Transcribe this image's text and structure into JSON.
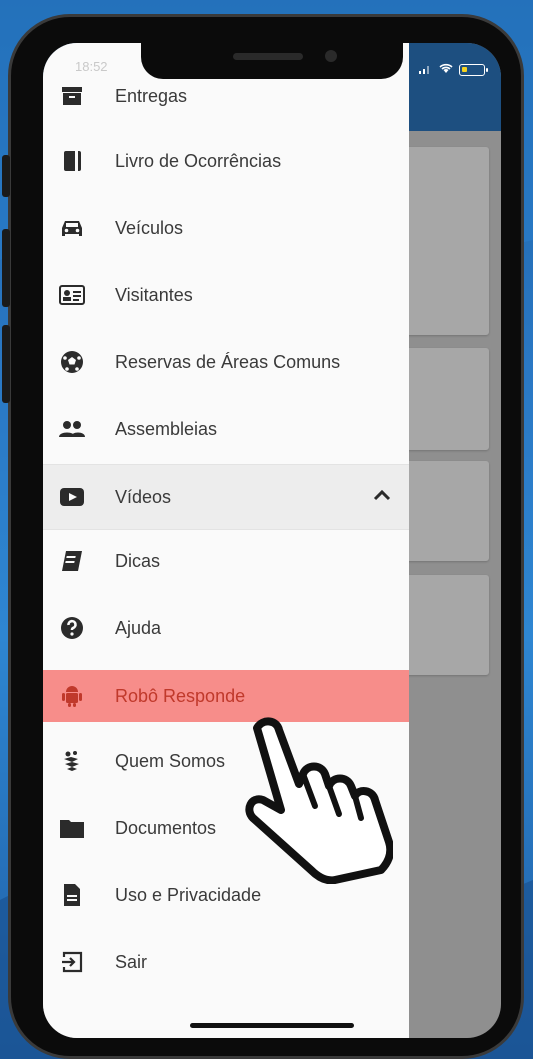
{
  "status_bar": {
    "time": "18:52"
  },
  "drawer": {
    "items": [
      {
        "label": "Entregas",
        "icon": "archive-box-icon"
      },
      {
        "label": "Livro de Ocorrências",
        "icon": "book-icon"
      },
      {
        "label": "Veículos",
        "icon": "car-icon"
      },
      {
        "label": "Visitantes",
        "icon": "id-card-icon"
      },
      {
        "label": "Reservas de Áreas Comuns",
        "icon": "soccer-ball-icon"
      },
      {
        "label": "Assembleias",
        "icon": "people-icon"
      },
      {
        "label": "Vídeos",
        "icon": "play-video-icon",
        "expanded": true
      },
      {
        "label": "Dicas",
        "icon": "notebook-icon"
      },
      {
        "label": "Ajuda",
        "icon": "help-circle-icon"
      },
      {
        "label": "Robô Responde",
        "icon": "android-robot-icon",
        "highlighted": true
      },
      {
        "label": "Quem Somos",
        "icon": "leaf-logo-icon"
      },
      {
        "label": "Documentos",
        "icon": "folder-icon"
      },
      {
        "label": "Uso e Privacidade",
        "icon": "document-icon"
      },
      {
        "label": "Sair",
        "icon": "logout-icon"
      }
    ]
  },
  "colors": {
    "header": "#1d4f80",
    "highlight": "#f78d8a",
    "highlight_text": "#c0392b"
  }
}
